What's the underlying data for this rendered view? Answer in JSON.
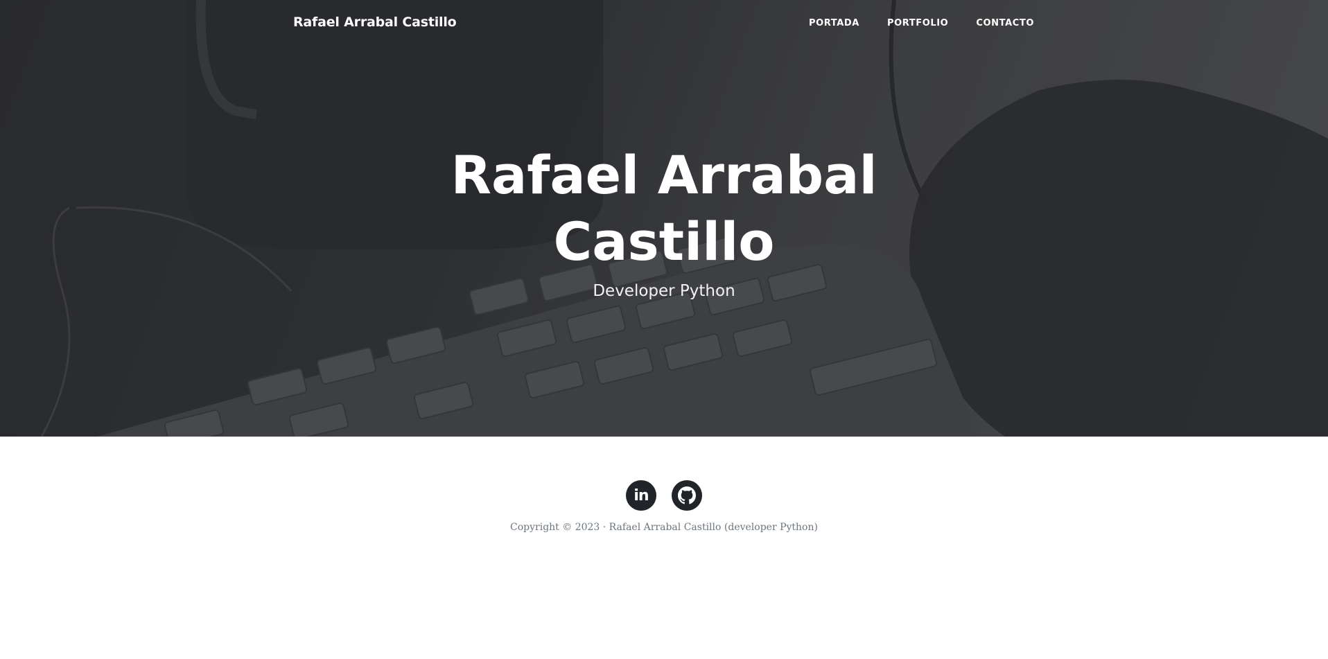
{
  "navbar": {
    "brand": "Rafael Arrabal Castillo",
    "links": [
      {
        "label": "PORTADA"
      },
      {
        "label": "PORTFOLIO"
      },
      {
        "label": "CONTACTO"
      }
    ]
  },
  "hero": {
    "title": "Rafael Arrabal Castillo",
    "subtitle": "Developer Python",
    "background": "photo-keyboard-mouse-desk"
  },
  "footer": {
    "social": [
      {
        "icon": "linkedin-icon",
        "glyph": "in"
      },
      {
        "icon": "github-icon"
      }
    ],
    "copyright": "Copyright © 2023 · Rafael Arrabal Castillo (developer Python)"
  },
  "colors": {
    "overlay": "#2f3034",
    "text_light": "#ffffff",
    "social_bg": "#212529",
    "copyright_text": "#6c757d"
  }
}
